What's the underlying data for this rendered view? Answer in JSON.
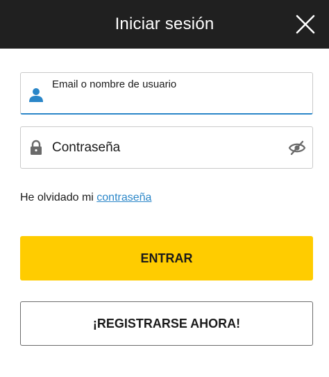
{
  "header": {
    "title": "Iniciar sesión"
  },
  "form": {
    "email": {
      "label": "Email o nombre de usuario",
      "value": "",
      "icon": "user-icon"
    },
    "password": {
      "label": "Contraseña",
      "value": "",
      "icon": "lock-icon",
      "toggle_icon": "eye-slash-icon"
    }
  },
  "forgot": {
    "prefix": "He olvidado mi ",
    "link": "contraseña"
  },
  "buttons": {
    "login": "ENTRAR",
    "register": "¡REGISTRARSE AHORA!"
  },
  "colors": {
    "header_bg": "#202020",
    "accent_blue": "#2a86c8",
    "primary_yellow": "#ffcc00"
  }
}
